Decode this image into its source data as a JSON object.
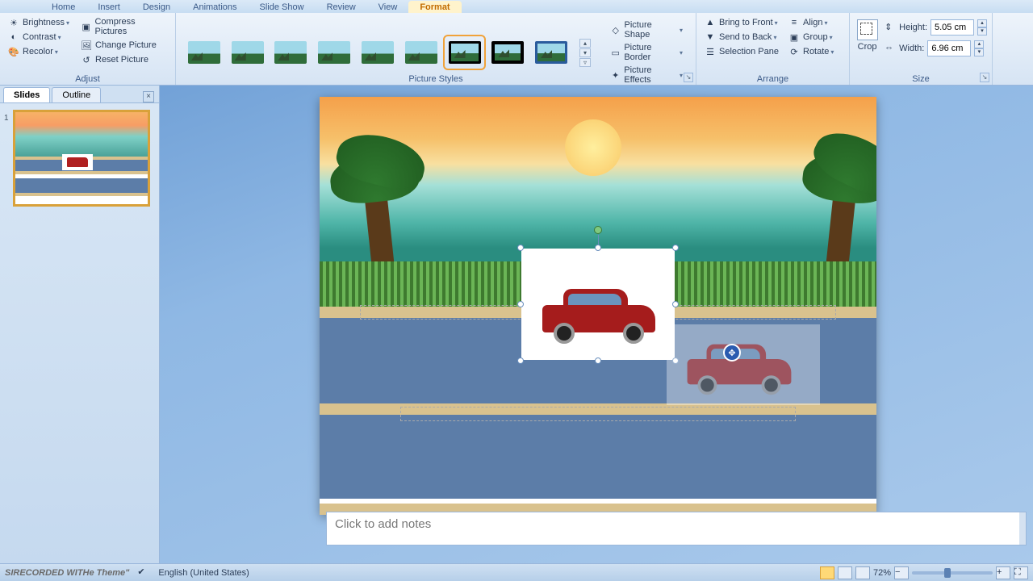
{
  "tabs": {
    "home": "Home",
    "insert": "Insert",
    "design": "Design",
    "animations": "Animations",
    "slideshow": "Slide Show",
    "review": "Review",
    "view": "View",
    "format": "Format"
  },
  "ribbon": {
    "adjust": {
      "label": "Adjust",
      "brightness": "Brightness",
      "contrast": "Contrast",
      "recolor": "Recolor",
      "compress": "Compress Pictures",
      "change": "Change Picture",
      "reset": "Reset Picture"
    },
    "styles": {
      "label": "Picture Styles",
      "shape": "Picture Shape",
      "border": "Picture Border",
      "effects": "Picture Effects"
    },
    "arrange": {
      "label": "Arrange",
      "front": "Bring to Front",
      "back": "Send to Back",
      "selpane": "Selection Pane",
      "align": "Align",
      "group": "Group",
      "rotate": "Rotate"
    },
    "size": {
      "label": "Size",
      "crop": "Crop",
      "height_lbl": "Height:",
      "width_lbl": "Width:",
      "height_val": "5.05 cm",
      "width_val": "6.96 cm"
    }
  },
  "pane": {
    "slides": "Slides",
    "outline": "Outline",
    "slide_num": "1"
  },
  "notes": {
    "placeholder": "Click to add notes"
  },
  "status": {
    "watermark": "SIRECORDED WITHe Theme\"",
    "lang": "English (United States)",
    "zoom": "72%"
  }
}
